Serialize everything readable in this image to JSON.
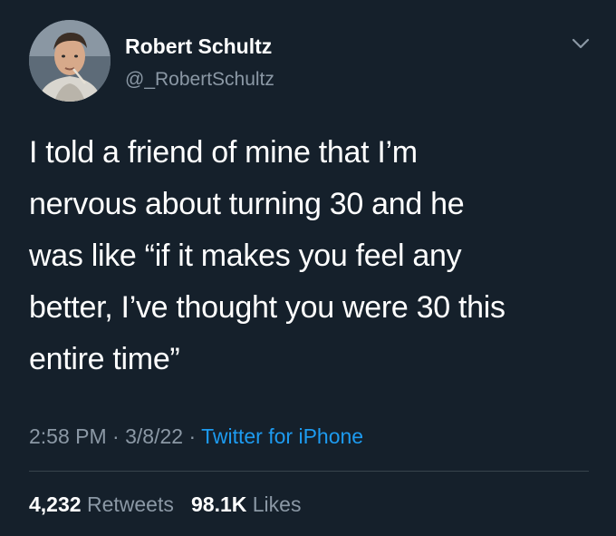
{
  "tweet": {
    "author": {
      "name": "Robert Schultz",
      "handle": "@_RobertSchultz",
      "avatar_icon": "profile-photo"
    },
    "menu_icon": "chevron-down-icon",
    "text": "I told a friend of mine that I’m\nnervous about turning 30 and he\nwas like “if it makes you feel any\nbetter, I’ve thought you were 30 this\nentire time”",
    "time": "2:58 PM",
    "separator": "·",
    "date": "3/8/22",
    "source": "Twitter for iPhone",
    "stats": {
      "retweets_count": "4,232",
      "retweets_label": "Retweets",
      "likes_count": "98.1K",
      "likes_label": "Likes"
    }
  },
  "colors": {
    "background": "#15202b",
    "primary_text": "#ffffff",
    "secondary_text": "#8b98a5",
    "link": "#1d9bf0",
    "divider": "#38444d"
  }
}
